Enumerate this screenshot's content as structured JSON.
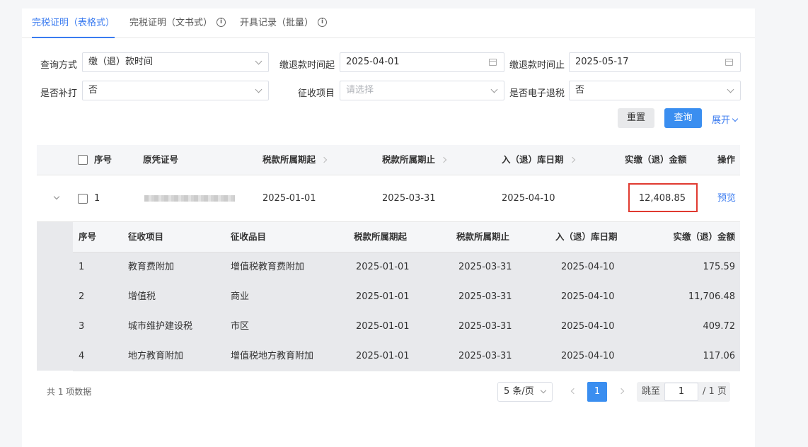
{
  "tabs": [
    {
      "label": "完税证明（表格式）"
    },
    {
      "label": "完税证明（文书式）"
    },
    {
      "label": "开具记录（批量）"
    }
  ],
  "form": {
    "query_method": {
      "label": "查询方式",
      "value": "缴（退）款时间"
    },
    "start_time": {
      "label": "缴退款时间起",
      "value": "2025-04-01"
    },
    "end_time": {
      "label": "缴退款时间止",
      "value": "2025-05-17"
    },
    "reprint": {
      "label": "是否补打",
      "value": "否"
    },
    "levy_item": {
      "label": "征收项目",
      "placeholder": "请选择"
    },
    "e_refund": {
      "label": "是否电子退税",
      "value": "否"
    },
    "reset_label": "重置",
    "query_label": "查询",
    "expand_label": "展开"
  },
  "table": {
    "headers": {
      "seq": "序号",
      "voucher": "原凭证号",
      "period_start": "税款所属期起",
      "period_end": "税款所属期止",
      "store_date": "入（退）库日期",
      "amount": "实缴（退）金额",
      "action": "操作"
    },
    "rows": [
      {
        "seq": "1",
        "period_start": "2025-01-01",
        "period_end": "2025-03-31",
        "store_date": "2025-04-10",
        "amount": "12,408.85",
        "action": "预览"
      }
    ]
  },
  "detail": {
    "headers": {
      "seq": "序号",
      "item": "征收项目",
      "category": "征收品目",
      "period_start": "税款所属期起",
      "period_end": "税款所属期止",
      "store_date": "入（退）库日期",
      "amount": "实缴（退）金额"
    },
    "rows": [
      {
        "seq": "1",
        "item": "教育费附加",
        "category": "增值税教育费附加",
        "period_start": "2025-01-01",
        "period_end": "2025-03-31",
        "store_date": "2025-04-10",
        "amount": "175.59"
      },
      {
        "seq": "2",
        "item": "增值税",
        "category": "商业",
        "period_start": "2025-01-01",
        "period_end": "2025-03-31",
        "store_date": "2025-04-10",
        "amount": "11,706.48"
      },
      {
        "seq": "3",
        "item": "城市维护建设税",
        "category": "市区",
        "period_start": "2025-01-01",
        "period_end": "2025-03-31",
        "store_date": "2025-04-10",
        "amount": "409.72"
      },
      {
        "seq": "4",
        "item": "地方教育附加",
        "category": "增值税地方教育附加",
        "period_start": "2025-01-01",
        "period_end": "2025-03-31",
        "store_date": "2025-04-10",
        "amount": "117.06"
      }
    ]
  },
  "pagination": {
    "total_text": "共 1 项数据",
    "page_size": "5 条/页",
    "current_page": "1",
    "jump_label": "跳至",
    "jump_value": "1",
    "total_pages": "/ 1 页"
  },
  "colors": {
    "accent": "#3a8ef0",
    "highlight": "#e03a30"
  }
}
